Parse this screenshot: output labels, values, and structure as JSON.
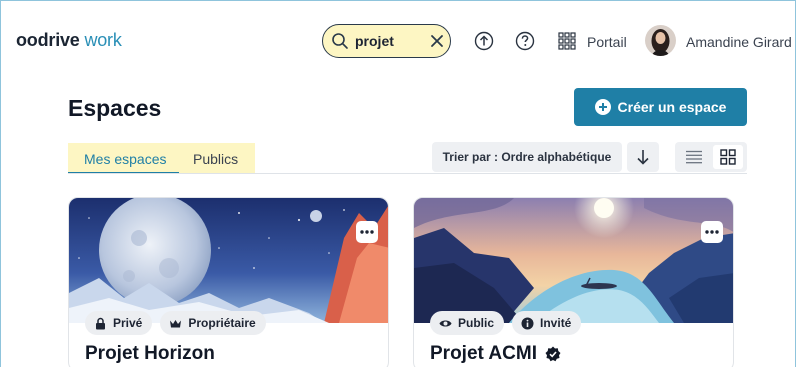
{
  "header": {
    "logo_main": "oodrive",
    "logo_accent": "work",
    "search_value": "projet",
    "portal_label": "Portail",
    "user_name": "Amandine Girard"
  },
  "page": {
    "title": "Espaces",
    "create_button_label": "Créer un espace"
  },
  "tabs": [
    {
      "label": "Mes espaces",
      "active": true
    },
    {
      "label": "Publics",
      "active": false
    }
  ],
  "sort": {
    "label": "Trier par : Ordre alphabétique"
  },
  "cards": [
    {
      "title": "Projet Horizon",
      "badges": [
        {
          "icon": "lock-icon",
          "label": "Privé"
        },
        {
          "icon": "crown-icon",
          "label": "Propriétaire"
        }
      ],
      "verified": false
    },
    {
      "title": "Projet ACMI",
      "badges": [
        {
          "icon": "eye-icon",
          "label": "Public"
        },
        {
          "icon": "info-icon",
          "label": "Invité"
        }
      ],
      "verified": true
    }
  ],
  "colors": {
    "accent": "#1f7fa6",
    "highlight": "#fdf6c3"
  }
}
